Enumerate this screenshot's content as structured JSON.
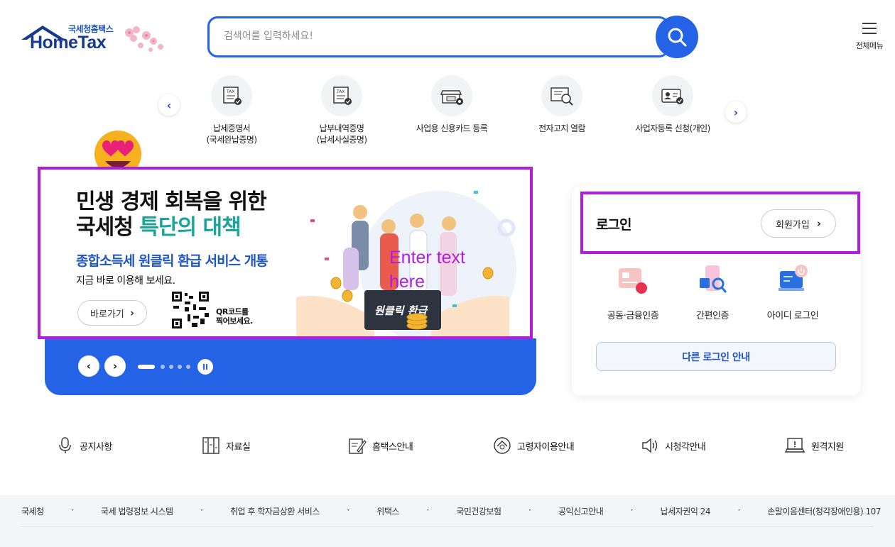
{
  "header": {
    "logo_sub": "국세청홈택스",
    "logo_main": "HomeTax",
    "search_placeholder": "검색어를 입력하세요!",
    "menu_label": "전체메뉴"
  },
  "quick_menu": [
    {
      "line1": "납세증명서",
      "line2": "(국세완납증명)",
      "icon": "tax-certificate-icon"
    },
    {
      "line1": "납부내역증명",
      "line2": "(납세사실증명)",
      "icon": "payment-history-icon"
    },
    {
      "line1": "사업용 신용카드 등록",
      "line2": "",
      "icon": "credit-card-icon"
    },
    {
      "line1": "전자고지 열람",
      "line2": "",
      "icon": "e-notice-icon"
    },
    {
      "line1": "사업자등록 신청(개인)",
      "line2": "",
      "icon": "business-registration-icon"
    }
  ],
  "banner": {
    "title_line1": "민생 경제 회복을 위한",
    "title_line2_a": "국세청 ",
    "title_line2_b": "특단의 대책",
    "subtitle": "종합소득세 원클릭 환급 서비스 개통",
    "subtitle2": "지금 바로 이용해 보세요.",
    "go_button": "바로가기",
    "qr_text_line1": "QR코드를",
    "qr_text_line2": "찍어보세요.",
    "sign_text": "원클릭 환급",
    "overlay_line1": "Enter text",
    "overlay_line2": "here",
    "slide_count": 5,
    "active_slide": 1
  },
  "login": {
    "title": "로그인",
    "join_button": "회원가입",
    "options": [
      {
        "label": "공동·금융인증",
        "icon": "certificate-icon"
      },
      {
        "label": "간편인증",
        "icon": "simple-auth-icon"
      },
      {
        "label": "아이디 로그인",
        "icon": "id-login-icon"
      }
    ],
    "other_login": "다른 로그인 안내"
  },
  "links": [
    {
      "label": "공지사항",
      "icon": "microphone-icon"
    },
    {
      "label": "자료실",
      "icon": "archive-icon"
    },
    {
      "label": "홈택스안내",
      "icon": "guide-icon"
    },
    {
      "label": "고령자이용안내",
      "icon": "senior-icon"
    },
    {
      "label": "시청각안내",
      "icon": "speaker-icon"
    },
    {
      "label": "원격지원",
      "icon": "remote-support-icon"
    }
  ],
  "footer": {
    "links": [
      "국세청",
      "국세 법령정보 시스템",
      "취업 후 학자금상환 서비스",
      "위택스",
      "국민건강보험",
      "공익신고안내",
      "납세자권익 24",
      "손말이음센터(청각장애인용) 107"
    ]
  },
  "colors": {
    "primary": "#2563e6",
    "highlight_border": "#b21ee0",
    "teal": "#1aa59b"
  }
}
